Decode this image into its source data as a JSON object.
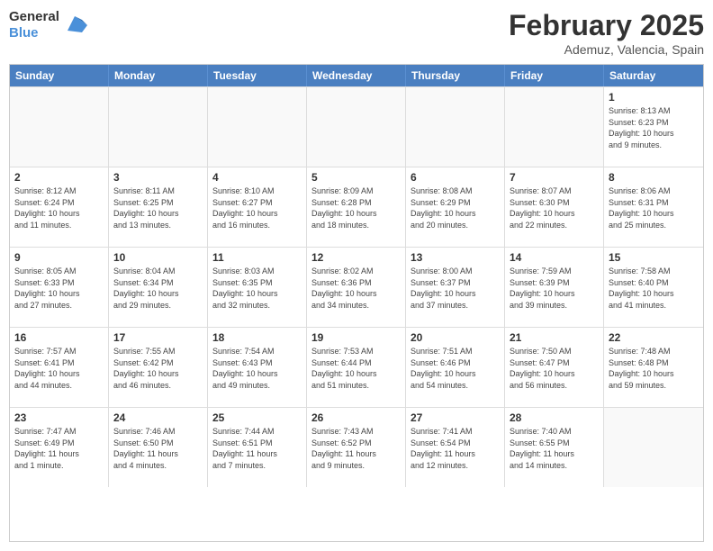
{
  "logo": {
    "general": "General",
    "blue": "Blue"
  },
  "title": "February 2025",
  "subtitle": "Ademuz, Valencia, Spain",
  "header": {
    "days": [
      "Sunday",
      "Monday",
      "Tuesday",
      "Wednesday",
      "Thursday",
      "Friday",
      "Saturday"
    ]
  },
  "weeks": [
    [
      {
        "day": "",
        "info": ""
      },
      {
        "day": "",
        "info": ""
      },
      {
        "day": "",
        "info": ""
      },
      {
        "day": "",
        "info": ""
      },
      {
        "day": "",
        "info": ""
      },
      {
        "day": "",
        "info": ""
      },
      {
        "day": "1",
        "info": "Sunrise: 8:13 AM\nSunset: 6:23 PM\nDaylight: 10 hours\nand 9 minutes."
      }
    ],
    [
      {
        "day": "2",
        "info": "Sunrise: 8:12 AM\nSunset: 6:24 PM\nDaylight: 10 hours\nand 11 minutes."
      },
      {
        "day": "3",
        "info": "Sunrise: 8:11 AM\nSunset: 6:25 PM\nDaylight: 10 hours\nand 13 minutes."
      },
      {
        "day": "4",
        "info": "Sunrise: 8:10 AM\nSunset: 6:27 PM\nDaylight: 10 hours\nand 16 minutes."
      },
      {
        "day": "5",
        "info": "Sunrise: 8:09 AM\nSunset: 6:28 PM\nDaylight: 10 hours\nand 18 minutes."
      },
      {
        "day": "6",
        "info": "Sunrise: 8:08 AM\nSunset: 6:29 PM\nDaylight: 10 hours\nand 20 minutes."
      },
      {
        "day": "7",
        "info": "Sunrise: 8:07 AM\nSunset: 6:30 PM\nDaylight: 10 hours\nand 22 minutes."
      },
      {
        "day": "8",
        "info": "Sunrise: 8:06 AM\nSunset: 6:31 PM\nDaylight: 10 hours\nand 25 minutes."
      }
    ],
    [
      {
        "day": "9",
        "info": "Sunrise: 8:05 AM\nSunset: 6:33 PM\nDaylight: 10 hours\nand 27 minutes."
      },
      {
        "day": "10",
        "info": "Sunrise: 8:04 AM\nSunset: 6:34 PM\nDaylight: 10 hours\nand 29 minutes."
      },
      {
        "day": "11",
        "info": "Sunrise: 8:03 AM\nSunset: 6:35 PM\nDaylight: 10 hours\nand 32 minutes."
      },
      {
        "day": "12",
        "info": "Sunrise: 8:02 AM\nSunset: 6:36 PM\nDaylight: 10 hours\nand 34 minutes."
      },
      {
        "day": "13",
        "info": "Sunrise: 8:00 AM\nSunset: 6:37 PM\nDaylight: 10 hours\nand 37 minutes."
      },
      {
        "day": "14",
        "info": "Sunrise: 7:59 AM\nSunset: 6:39 PM\nDaylight: 10 hours\nand 39 minutes."
      },
      {
        "day": "15",
        "info": "Sunrise: 7:58 AM\nSunset: 6:40 PM\nDaylight: 10 hours\nand 41 minutes."
      }
    ],
    [
      {
        "day": "16",
        "info": "Sunrise: 7:57 AM\nSunset: 6:41 PM\nDaylight: 10 hours\nand 44 minutes."
      },
      {
        "day": "17",
        "info": "Sunrise: 7:55 AM\nSunset: 6:42 PM\nDaylight: 10 hours\nand 46 minutes."
      },
      {
        "day": "18",
        "info": "Sunrise: 7:54 AM\nSunset: 6:43 PM\nDaylight: 10 hours\nand 49 minutes."
      },
      {
        "day": "19",
        "info": "Sunrise: 7:53 AM\nSunset: 6:44 PM\nDaylight: 10 hours\nand 51 minutes."
      },
      {
        "day": "20",
        "info": "Sunrise: 7:51 AM\nSunset: 6:46 PM\nDaylight: 10 hours\nand 54 minutes."
      },
      {
        "day": "21",
        "info": "Sunrise: 7:50 AM\nSunset: 6:47 PM\nDaylight: 10 hours\nand 56 minutes."
      },
      {
        "day": "22",
        "info": "Sunrise: 7:48 AM\nSunset: 6:48 PM\nDaylight: 10 hours\nand 59 minutes."
      }
    ],
    [
      {
        "day": "23",
        "info": "Sunrise: 7:47 AM\nSunset: 6:49 PM\nDaylight: 11 hours\nand 1 minute."
      },
      {
        "day": "24",
        "info": "Sunrise: 7:46 AM\nSunset: 6:50 PM\nDaylight: 11 hours\nand 4 minutes."
      },
      {
        "day": "25",
        "info": "Sunrise: 7:44 AM\nSunset: 6:51 PM\nDaylight: 11 hours\nand 7 minutes."
      },
      {
        "day": "26",
        "info": "Sunrise: 7:43 AM\nSunset: 6:52 PM\nDaylight: 11 hours\nand 9 minutes."
      },
      {
        "day": "27",
        "info": "Sunrise: 7:41 AM\nSunset: 6:54 PM\nDaylight: 11 hours\nand 12 minutes."
      },
      {
        "day": "28",
        "info": "Sunrise: 7:40 AM\nSunset: 6:55 PM\nDaylight: 11 hours\nand 14 minutes."
      },
      {
        "day": "",
        "info": ""
      }
    ]
  ]
}
